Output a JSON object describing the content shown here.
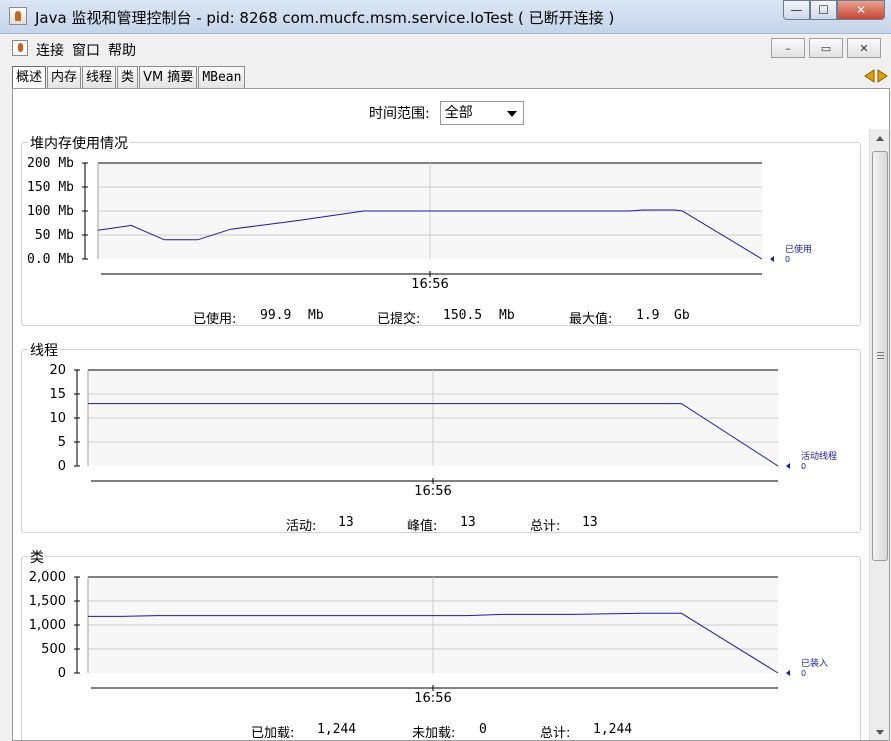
{
  "window": {
    "title": "Java 监视和管理控制台 - pid: 8268 com.mucfc.msm.service.IoTest ( 已断开连接 )",
    "buttons": {
      "minimize": "—",
      "maximize": "☐",
      "close": "✕"
    }
  },
  "menubar": {
    "items": [
      "连接",
      "窗口",
      "帮助"
    ],
    "inner_buttons": {
      "minimize": "–",
      "restore": "▭",
      "close": "✕"
    }
  },
  "tabs": [
    {
      "label": "概述",
      "active": true
    },
    {
      "label": "内存",
      "active": false
    },
    {
      "label": "线程",
      "active": false
    },
    {
      "label": "类",
      "active": false
    },
    {
      "label": "VM 摘要",
      "active": false
    },
    {
      "label": "MBean",
      "active": false
    }
  ],
  "time_range": {
    "label": "时间范围:",
    "selected": "全部"
  },
  "colors": {
    "series": "#1a1ab4",
    "grid": "#cccccc",
    "axis": "#000000"
  },
  "panels": {
    "heap": {
      "title": "堆内存使用情况",
      "stats": [
        {
          "label": "已使用:",
          "value": "99.9",
          "unit": "Mb"
        },
        {
          "label": "已提交:",
          "value": "150.5",
          "unit": "Mb"
        },
        {
          "label": "最大值:",
          "value": "1.9",
          "unit": "Gb"
        }
      ]
    },
    "threads": {
      "title": "线程",
      "stats": [
        {
          "label": "活动:",
          "value": "13"
        },
        {
          "label": "峰值:",
          "value": "13"
        },
        {
          "label": "总计:",
          "value": "13"
        }
      ]
    },
    "classes": {
      "title": "类",
      "stats": [
        {
          "label": "已加载:",
          "value": "1,244"
        },
        {
          "label": "未加载:",
          "value": "0"
        },
        {
          "label": "总计:",
          "value": "1,244"
        }
      ]
    }
  },
  "chart_data": [
    {
      "type": "line",
      "title": "堆内存使用情况",
      "yticks": [
        "0.0 Mb",
        "50 Mb",
        "100 Mb",
        "150 Mb",
        "200 Mb"
      ],
      "ylim": [
        0,
        200
      ],
      "xtick": "16:56",
      "grid": true,
      "series": [
        {
          "name": "已使用",
          "legend_value": "0",
          "x": [
            0,
            0.05,
            0.1,
            0.15,
            0.2,
            0.3,
            0.4,
            0.5,
            0.6,
            0.7,
            0.8,
            0.82,
            0.87,
            0.88,
            1.0
          ],
          "y": [
            60,
            70,
            40,
            40,
            62,
            80,
            100,
            100,
            100,
            100,
            100,
            102,
            102,
            100,
            0
          ]
        }
      ]
    },
    {
      "type": "line",
      "title": "线程",
      "yticks": [
        "0",
        "5",
        "10",
        "15",
        "20"
      ],
      "ylim": [
        0,
        20
      ],
      "xtick": "16:56",
      "grid": true,
      "series": [
        {
          "name": "活动线程",
          "legend_value": "0",
          "x": [
            0,
            0.1,
            0.2,
            0.3,
            0.4,
            0.5,
            0.6,
            0.7,
            0.8,
            0.86,
            1.0
          ],
          "y": [
            13,
            13,
            13,
            13,
            13,
            13,
            13,
            13,
            13,
            13,
            0
          ]
        }
      ]
    },
    {
      "type": "line",
      "title": "类",
      "yticks": [
        "0",
        "500",
        "1,000",
        "1,500",
        "2,000"
      ],
      "ylim": [
        0,
        2000
      ],
      "xtick": "16:56",
      "grid": true,
      "series": [
        {
          "name": "已装入",
          "legend_value": "0",
          "x": [
            0,
            0.05,
            0.1,
            0.2,
            0.3,
            0.4,
            0.5,
            0.55,
            0.6,
            0.7,
            0.8,
            0.86,
            1.0
          ],
          "y": [
            1180,
            1180,
            1195,
            1195,
            1195,
            1195,
            1195,
            1195,
            1220,
            1220,
            1244,
            1244,
            0
          ]
        }
      ]
    }
  ]
}
